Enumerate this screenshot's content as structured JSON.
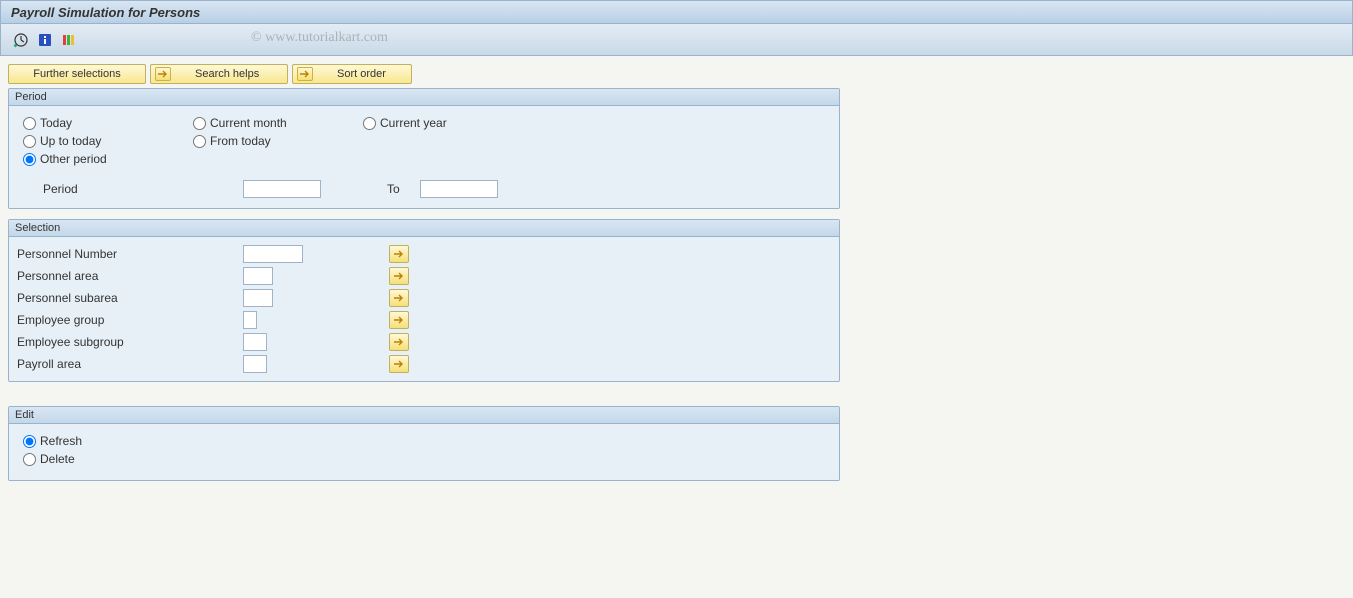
{
  "header": {
    "title": "Payroll Simulation for Persons"
  },
  "watermark": "© www.tutorialkart.com",
  "buttons": {
    "further_selections": "Further selections",
    "search_helps": "Search helps",
    "sort_order": "Sort order"
  },
  "period": {
    "group_title": "Period",
    "today": "Today",
    "current_month": "Current month",
    "current_year": "Current year",
    "up_to_today": "Up to today",
    "from_today": "From today",
    "other_period": "Other period",
    "period_label": "Period",
    "to_label": "To",
    "period_value": "",
    "to_value": ""
  },
  "selection": {
    "group_title": "Selection",
    "rows": [
      {
        "label": "Personnel Number",
        "value": ""
      },
      {
        "label": "Personnel area",
        "value": ""
      },
      {
        "label": "Personnel subarea",
        "value": ""
      },
      {
        "label": "Employee group",
        "value": ""
      },
      {
        "label": "Employee subgroup",
        "value": ""
      },
      {
        "label": "Payroll area",
        "value": ""
      }
    ]
  },
  "edit": {
    "group_title": "Edit",
    "refresh": "Refresh",
    "delete": "Delete"
  }
}
